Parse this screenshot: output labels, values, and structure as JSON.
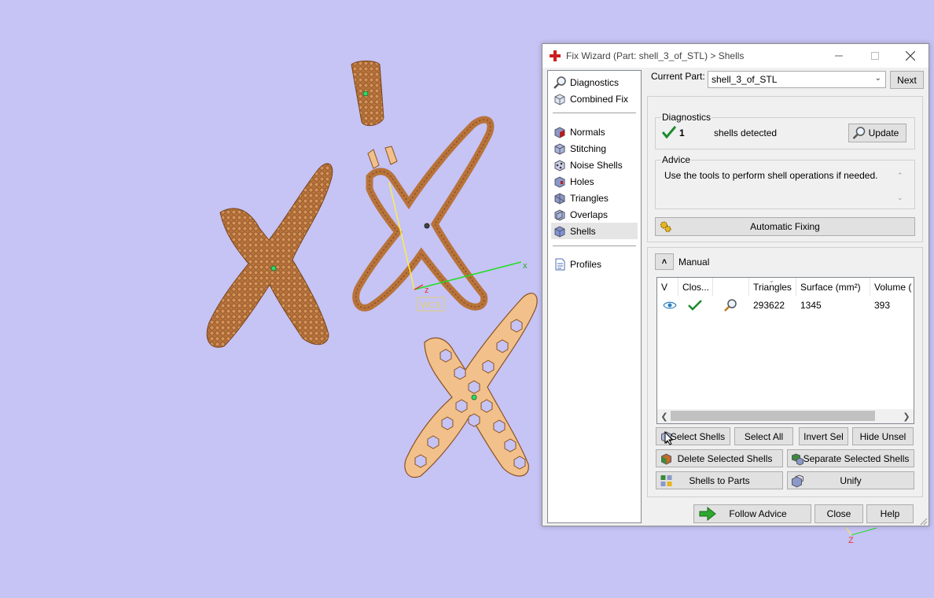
{
  "window": {
    "title": "Fix Wizard (Part: shell_3_of_STL) > Shells"
  },
  "nav": {
    "items": [
      {
        "label": "Diagnostics",
        "icon": "magnifier-icon"
      },
      {
        "label": "Combined Fix",
        "icon": "cube-icon"
      },
      {
        "label": "Normals",
        "icon": "normals-cube-icon"
      },
      {
        "label": "Stitching",
        "icon": "stitching-cube-icon"
      },
      {
        "label": "Noise Shells",
        "icon": "noise-shells-icon"
      },
      {
        "label": "Holes",
        "icon": "holes-cube-icon"
      },
      {
        "label": "Triangles",
        "icon": "triangles-cube-icon"
      },
      {
        "label": "Overlaps",
        "icon": "overlaps-cube-icon"
      },
      {
        "label": "Shells",
        "icon": "shells-cube-icon",
        "selected": true
      },
      {
        "label": "Profiles",
        "icon": "document-icon"
      }
    ]
  },
  "current_part": {
    "label": "Current Part:",
    "value": "shell_3_of_STL",
    "next_label": "Next"
  },
  "diagnostics": {
    "group_label": "Diagnostics",
    "count": "1",
    "text": "shells detected",
    "update_label": "Update"
  },
  "advice": {
    "group_label": "Advice",
    "text": "Use the tools to perform shell operations if needed."
  },
  "automatic_fixing_label": "Automatic Fixing",
  "manual": {
    "label": "Manual",
    "columns": [
      "V",
      "Clos...",
      "",
      "Triangles",
      "Surface (mm²)",
      "Volume ("
    ],
    "rows": [
      {
        "triangles": "293622",
        "surface": "1345",
        "volume": "393"
      }
    ],
    "buttons": {
      "select_shells": "Select Shells",
      "select_all": "Select All",
      "invert_sel": "Invert Sel",
      "hide_unsel": "Hide Unsel",
      "delete_selected": "Delete Selected Shells",
      "separate_selected": "Separate Selected Shells",
      "shells_to_parts": "Shells to Parts",
      "unify": "Unify"
    }
  },
  "footer": {
    "follow_advice": "Follow Advice",
    "close": "Close",
    "help": "Help"
  },
  "viewport": {
    "wcs_label": "WCS",
    "axis_x": "x",
    "axis_z": "z",
    "corner_axis_z": "Z",
    "colors": {
      "background": "#c6c3f5",
      "mesh_dark": "#b8733a",
      "mesh_light": "#f2c08a",
      "x_axis": "#22dd22",
      "y_axis": "#ffee44",
      "z_axis": "#ee3333"
    }
  },
  "accent_colors": {
    "check": "#1c8a2e",
    "arrow": "#2ea82e",
    "app_icon": "#cc1f1f"
  }
}
